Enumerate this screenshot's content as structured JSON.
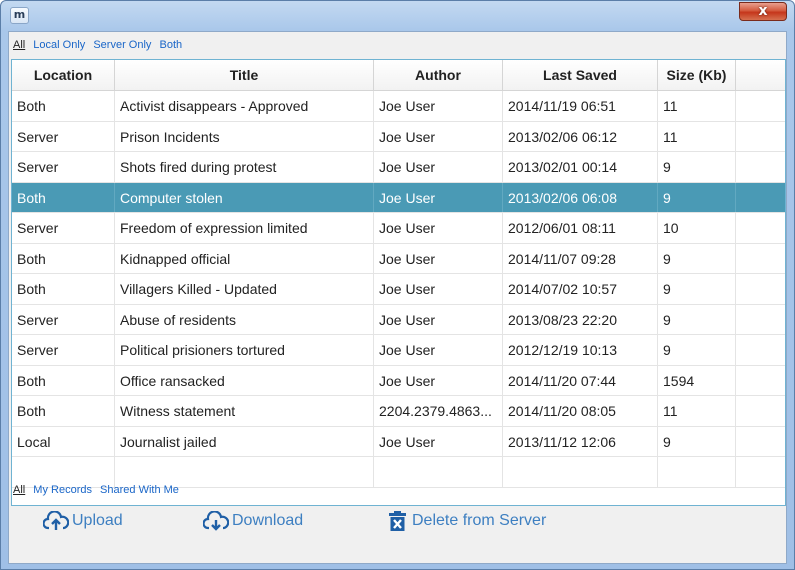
{
  "window": {
    "app_icon_letter": "m",
    "close_label": "x"
  },
  "filters": {
    "location": [
      "All",
      "Local Only",
      "Server Only",
      "Both"
    ],
    "scope": [
      "All",
      "My Records",
      "Shared With Me"
    ]
  },
  "table": {
    "columns": [
      "Location",
      "Title",
      "Author",
      "Last Saved",
      "Size (Kb)"
    ],
    "rows": [
      [
        "Both",
        "Activist disappears - Approved",
        "Joe User",
        "2014/11/19 06:51",
        "11"
      ],
      [
        "Server",
        "Prison Incidents",
        "Joe User",
        "2013/02/06 06:12",
        "11"
      ],
      [
        "Server",
        "Shots fired during protest",
        "Joe User",
        "2013/02/01 00:14",
        "9"
      ],
      [
        "Both",
        "Computer stolen",
        "Joe User",
        "2013/02/06 06:08",
        "9"
      ],
      [
        "Server",
        "Freedom of expression limited",
        "Joe User",
        "2012/06/01 08:11",
        "10"
      ],
      [
        "Both",
        "Kidnapped official",
        "Joe User",
        "2014/11/07 09:28",
        "9"
      ],
      [
        "Both",
        "Villagers Killed - Updated",
        "Joe User",
        "2014/07/02 10:57",
        "9"
      ],
      [
        "Server",
        "Abuse of residents",
        "Joe User",
        "2013/08/23 22:20",
        "9"
      ],
      [
        "Server",
        "Political prisioners tortured",
        "Joe User",
        "2012/12/19 10:13",
        "9"
      ],
      [
        "Both",
        "Office ransacked",
        "Joe User",
        "2014/11/20 07:44",
        "1594"
      ],
      [
        "Both",
        "Witness statement",
        "2204.2379.4863...",
        "2014/11/20 08:05",
        "11"
      ],
      [
        "Local",
        "Journalist jailed",
        "Joe User",
        "2013/11/12 12:06",
        "9"
      ],
      [
        "",
        "",
        "",
        "",
        ""
      ]
    ],
    "selected_row_index": 3
  },
  "actions": {
    "upload": "Upload",
    "download": "Download",
    "delete": "Delete from Server"
  },
  "colors": {
    "accent": "#3d7fc1",
    "selection": "#4a9ab5",
    "link": "#1a66c8"
  },
  "icons": {
    "upload": "cloud-upload-icon",
    "download": "cloud-download-icon",
    "delete": "trash-icon",
    "close": "close-icon"
  }
}
